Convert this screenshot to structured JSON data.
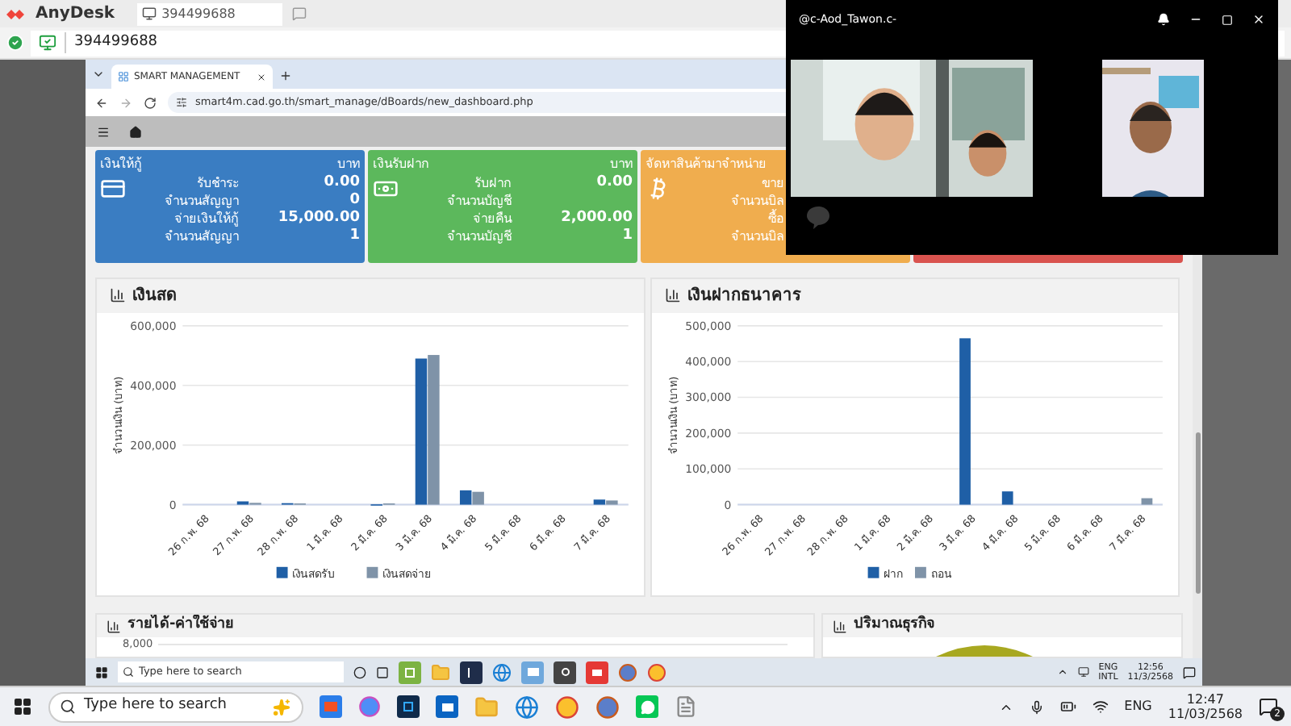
{
  "anydesk": {
    "app_name": "AnyDesk",
    "tab_label": "394499688",
    "address": "394499688"
  },
  "browser": {
    "tab_title": "SMART MANAGEMENT",
    "url": "smart4m.cad.go.th/smart_manage/dBoards/new_dashboard.php"
  },
  "cards": [
    {
      "kind": "loan",
      "color": "#3a7dc2",
      "title": "เงินให้กู้",
      "unit": "บาท",
      "rows": [
        {
          "label": "รับชำระ",
          "value": "0.00"
        },
        {
          "label": "จำนวนสัญญา",
          "value": "0"
        },
        {
          "label": "จ่ายเงินให้กู้",
          "value": "15,000.00"
        },
        {
          "label": "จำนวนสัญญา",
          "value": "1"
        }
      ]
    },
    {
      "kind": "deposit",
      "color": "#5cb85c",
      "title": "เงินรับฝาก",
      "unit": "บาท",
      "rows": [
        {
          "label": "รับฝาก",
          "value": "0.00"
        },
        {
          "label": "จำนวนบัญชี"
        },
        {
          "label": "จ่ายคืน",
          "value": "2,000.00"
        },
        {
          "label": "จำนวนบัญชี",
          "value": "1"
        }
      ]
    },
    {
      "kind": "trade",
      "color": "#f0ad4e",
      "title": "จัดหาสินค้ามาจำหน่าย",
      "rows": [
        {
          "label": "ขาย"
        },
        {
          "label": "จำนวนบิล"
        },
        {
          "label": "ซื้อ"
        },
        {
          "label": "จำนวนบิล"
        }
      ]
    },
    {
      "color": "#d9534f"
    }
  ],
  "charts": [
    {
      "chart_data": {
        "type": "bar",
        "title": "เงินสด",
        "ylabel": "จำนวนเงิน (บาท)",
        "categories": [
          "26 ก.พ. 68",
          "27 ก.พ. 68",
          "28 ก.พ. 68",
          "1 มี.ค. 68",
          "2 มี.ค. 68",
          "3 มี.ค. 68",
          "4 มี.ค. 68",
          "5 มี.ค. 68",
          "6 มี.ค. 68",
          "7 มี.ค. 68"
        ],
        "ylim": [
          0,
          600000
        ],
        "yticks": [
          0,
          {
            "value": 200000,
            "label": "200,000"
          },
          {
            "value": 400000,
            "label": "400,000"
          },
          {
            "value": 600000,
            "label": "600,000"
          }
        ],
        "grid": true,
        "legend": "bottom",
        "series": [
          {
            "name": "เงินสดรับ",
            "color": "#1f5fa6",
            "values": [
              0,
              11000,
              5000,
              0,
              1000,
              490000,
              48000,
              0,
              0,
              17000
            ]
          },
          {
            "name": "เงินสดจ่าย",
            "color": "#7f93a8",
            "values": [
              0,
              6000,
              4000,
              0,
              4000,
              502000,
              43000,
              0,
              0,
              14000
            ]
          }
        ]
      }
    },
    {
      "chart_data": {
        "type": "bar",
        "title": "เงินฝากธนาคาร",
        "ylabel": "จำนวนเงิน (บาท)",
        "categories": [
          "26 ก.พ. 68",
          "27 ก.พ. 68",
          "28 ก.พ. 68",
          "1 มี.ค. 68",
          "2 มี.ค. 68",
          "3 มี.ค. 68",
          "4 มี.ค. 68",
          "5 มี.ค. 68",
          "6 มี.ค. 68",
          "7 มี.ค. 68"
        ],
        "ylim": [
          0,
          500000
        ],
        "yticks": [
          0,
          {
            "value": 100000,
            "label": "100,000"
          },
          {
            "value": 200000,
            "label": "200,000"
          },
          {
            "value": 300000,
            "label": "300,000"
          },
          {
            "value": 400000,
            "label": "400,000"
          },
          {
            "value": 500000,
            "label": "500,000"
          }
        ],
        "grid": true,
        "legend": "bottom",
        "series": [
          {
            "name": "ฝาก",
            "color": "#1f5fa6",
            "values": [
              0,
              0,
              0,
              0,
              0,
              465000,
              37000,
              0,
              0,
              0
            ]
          },
          {
            "name": "ถอน",
            "color": "#7f93a8",
            "values": [
              0,
              0,
              0,
              0,
              0,
              0,
              0,
              0,
              0,
              18000
            ]
          }
        ]
      }
    }
  ],
  "bottom_panels": [
    {
      "title": "รายได้-ค่าใช้จ่าย",
      "tick": "8,000"
    },
    {
      "title": "ปริมาณธุรกิจ"
    }
  ],
  "remote_taskbar": {
    "search_text": "Type here to search",
    "language": "ENG",
    "layout": "INTL",
    "time": "12:56",
    "date": "11/3/2568"
  },
  "video_call": {
    "title": "@c-Aod_Tawon.c-"
  },
  "taskbar": {
    "search_text": "Type here to search",
    "language": "ENG",
    "time": "12:47",
    "date": "11/03/2568",
    "notification_count": "2"
  }
}
